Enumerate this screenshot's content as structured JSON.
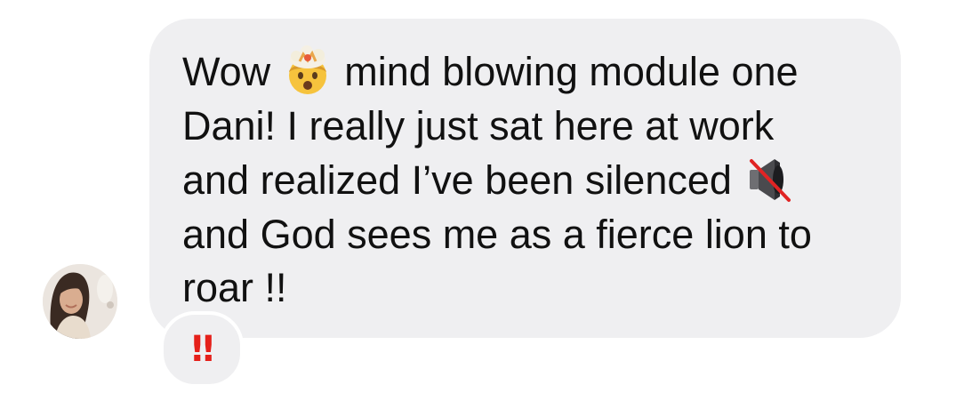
{
  "message": {
    "lines": [
      {
        "before": "Wow",
        "emoji": "exploding-head-icon",
        "after": "mind blowing module one"
      },
      {
        "text": "Dani! I really just sat here at work"
      },
      {
        "before": "and realized I’ve been silenced",
        "emoji": "muted-speaker-icon"
      },
      {
        "text": "and God sees me as a fierce lion to"
      },
      {
        "text": "roar !!"
      }
    ]
  },
  "reaction": {
    "glyph": "‼",
    "icon": "double-exclamation-icon",
    "color": "#e5201a"
  },
  "avatar": {
    "icon": "user-avatar-photo"
  },
  "colors": {
    "bubble": "#efeff1",
    "text": "#111111",
    "background": "#ffffff"
  }
}
